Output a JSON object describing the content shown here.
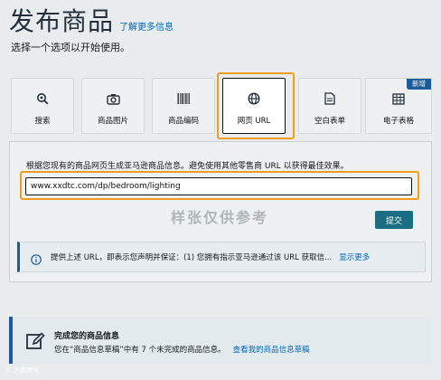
{
  "header": {
    "title": "发布商品",
    "learn_more": "了解更多信息",
    "subtitle": "选择一个选项以开始使用。"
  },
  "tiles": [
    {
      "label": "搜索",
      "icon": "search-icon"
    },
    {
      "label": "商品图片",
      "icon": "camera-icon"
    },
    {
      "label": "商品编码",
      "icon": "barcode-icon"
    },
    {
      "label": "网页 URL",
      "icon": "globe-icon",
      "selected": true
    },
    {
      "label": "空白表单",
      "icon": "document-icon"
    },
    {
      "label": "电子表格",
      "icon": "spreadsheet-icon",
      "badge": "新增"
    }
  ],
  "url_panel": {
    "description": "根据您现有的商品网页生成亚马逊商品信息。避免使用其他零售商 URL 以获得最佳效果。",
    "url_value": "www.xxdtc.com/dp/bedroom/lighting",
    "watermark": "样张仅供参考",
    "submit_label": "提交",
    "notice_text": "提供上述 URL，即表示您声明并保证：(1) 您拥有指示亚马逊通过该 URL 获取信...",
    "show_more": "显示更多"
  },
  "draft": {
    "title": "完成您的商品信息",
    "text": "您在“商品信息草稿”中有 7 个未完成的商品信息。",
    "link": "查看我的商品信息草稿"
  },
  "corner_mark": "© 大数跨境",
  "colors": {
    "highlight": "#f29d1d",
    "accent": "#1b5d9c",
    "button": "#1a6e84",
    "link": "#0066c0"
  }
}
